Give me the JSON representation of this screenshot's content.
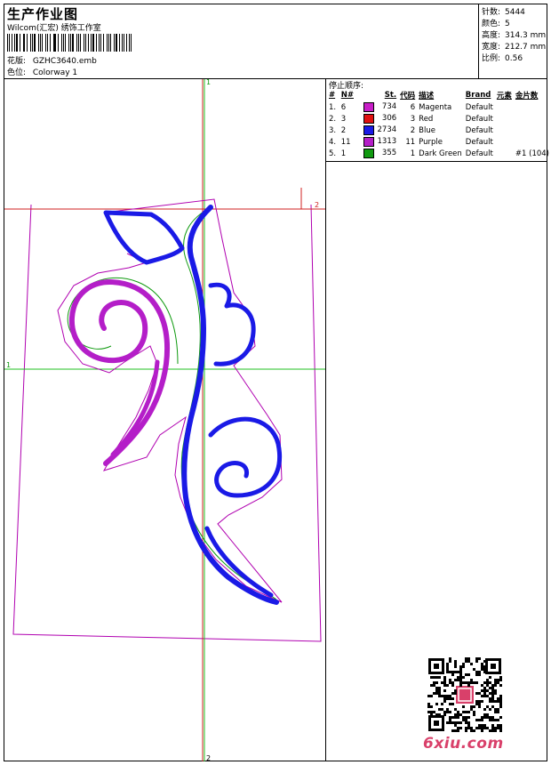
{
  "header": {
    "title": "生产作业图",
    "company": "Wilcom(汇宏) 绣饰工作室",
    "design_label": "花版:",
    "design_value": "GZHC3640.emb",
    "colorway_label": "色位:",
    "colorway_value": "Colorway 1"
  },
  "stats": [
    {
      "label": "针数:",
      "value": "5444"
    },
    {
      "label": "颜色:",
      "value": "5"
    },
    {
      "label": "高度:",
      "value": "314.3 mm"
    },
    {
      "label": "宽度:",
      "value": "212.7 mm"
    },
    {
      "label": "比例:",
      "value": "0.56"
    }
  ],
  "stop_sequence": {
    "title": "停止顺序:",
    "headers": [
      "#",
      "N#",
      "St.",
      "代码",
      "描述",
      "Brand",
      "元素",
      "金片数"
    ],
    "rows": [
      {
        "idx": "1.",
        "n": "6",
        "color": "#c81ec8",
        "st": "734",
        "code": "6",
        "desc": "Magenta",
        "brand": "Default",
        "elem": "",
        "seq": ""
      },
      {
        "idx": "2.",
        "n": "3",
        "color": "#e01010",
        "st": "306",
        "code": "3",
        "desc": "Red",
        "brand": "Default",
        "elem": "",
        "seq": ""
      },
      {
        "idx": "3.",
        "n": "2",
        "color": "#1a1ae6",
        "st": "2734",
        "code": "2",
        "desc": "Blue",
        "brand": "Default",
        "elem": "",
        "seq": ""
      },
      {
        "idx": "4.",
        "n": "11",
        "color": "#b41ec8",
        "st": "1313",
        "code": "11",
        "desc": "Purple",
        "brand": "Default",
        "elem": "",
        "seq": ""
      },
      {
        "idx": "5.",
        "n": "1",
        "color": "#109a10",
        "st": "355",
        "code": "1",
        "desc": "Dark Green",
        "brand": "Default",
        "elem": "",
        "seq": "#1 (104)"
      }
    ]
  },
  "design": {
    "axis_labels": {
      "v_top": "1",
      "v_bottom": "2",
      "h_left": "1",
      "h_right": "2"
    },
    "colors": {
      "outline": "#b000b0",
      "stem_fill": "#1a1ae6",
      "spiral": "#b41ec8",
      "green": "#109a10",
      "red_line": "#d02020",
      "green_line": "#20c020"
    }
  },
  "watermark": {
    "site": "6xiu.com"
  }
}
